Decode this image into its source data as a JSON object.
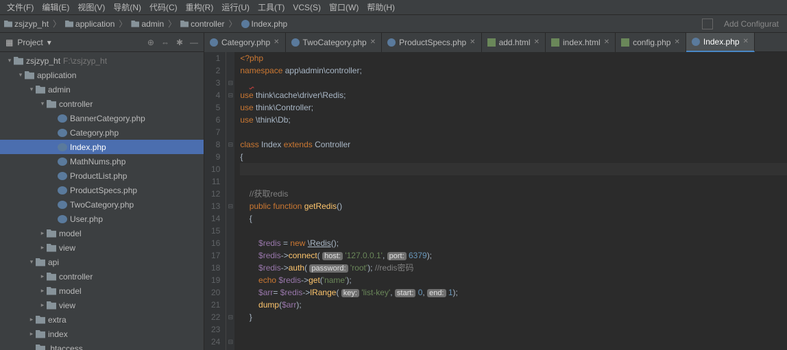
{
  "menus": [
    "文件(F)",
    "编辑(E)",
    "视图(V)",
    "导航(N)",
    "代码(C)",
    "重构(R)",
    "运行(U)",
    "工具(T)",
    "VCS(S)",
    "窗口(W)",
    "帮助(H)"
  ],
  "breadcrumb": {
    "items": [
      {
        "icon": "folder",
        "label": "zsjzyp_ht"
      },
      {
        "icon": "folder",
        "label": "application"
      },
      {
        "icon": "folder",
        "label": "admin"
      },
      {
        "icon": "folder",
        "label": "controller"
      },
      {
        "icon": "php",
        "label": "Index.php"
      }
    ],
    "add_config": "Add Configurat"
  },
  "project": {
    "title": "Project",
    "root": {
      "label": "zsjzyp_ht",
      "path": "F:\\zsjzyp_ht"
    },
    "nodes": [
      {
        "indent": 0,
        "arrow": "open",
        "icon": "folder",
        "label": "zsjzyp_ht",
        "path": "F:\\zsjzyp_ht"
      },
      {
        "indent": 1,
        "arrow": "open",
        "icon": "folder",
        "label": "application"
      },
      {
        "indent": 2,
        "arrow": "open",
        "icon": "folder",
        "label": "admin"
      },
      {
        "indent": 3,
        "arrow": "open",
        "icon": "folder",
        "label": "controller"
      },
      {
        "indent": 4,
        "arrow": "none",
        "icon": "php",
        "label": "BannerCategory.php"
      },
      {
        "indent": 4,
        "arrow": "none",
        "icon": "php",
        "label": "Category.php"
      },
      {
        "indent": 4,
        "arrow": "none",
        "icon": "php",
        "label": "Index.php",
        "selected": true
      },
      {
        "indent": 4,
        "arrow": "none",
        "icon": "php",
        "label": "MathNums.php"
      },
      {
        "indent": 4,
        "arrow": "none",
        "icon": "php",
        "label": "ProductList.php"
      },
      {
        "indent": 4,
        "arrow": "none",
        "icon": "php",
        "label": "ProductSpecs.php"
      },
      {
        "indent": 4,
        "arrow": "none",
        "icon": "php",
        "label": "TwoCategory.php"
      },
      {
        "indent": 4,
        "arrow": "none",
        "icon": "php",
        "label": "User.php"
      },
      {
        "indent": 3,
        "arrow": "closed",
        "icon": "folder",
        "label": "model"
      },
      {
        "indent": 3,
        "arrow": "closed",
        "icon": "folder",
        "label": "view"
      },
      {
        "indent": 2,
        "arrow": "open",
        "icon": "folder",
        "label": "api"
      },
      {
        "indent": 3,
        "arrow": "closed",
        "icon": "folder",
        "label": "controller"
      },
      {
        "indent": 3,
        "arrow": "closed",
        "icon": "folder",
        "label": "model"
      },
      {
        "indent": 3,
        "arrow": "closed",
        "icon": "folder",
        "label": "view"
      },
      {
        "indent": 2,
        "arrow": "closed",
        "icon": "folder",
        "label": "extra"
      },
      {
        "indent": 2,
        "arrow": "closed",
        "icon": "folder",
        "label": "index"
      },
      {
        "indent": 2,
        "arrow": "none",
        "icon": "file",
        "label": ".htaccess"
      }
    ]
  },
  "tabs": [
    {
      "icon": "php",
      "label": "Category.php"
    },
    {
      "icon": "php",
      "label": "TwoCategory.php"
    },
    {
      "icon": "php",
      "label": "ProductSpecs.php"
    },
    {
      "icon": "html",
      "label": "add.html"
    },
    {
      "icon": "html",
      "label": "index.html"
    },
    {
      "icon": "html",
      "label": "config.php"
    },
    {
      "icon": "php",
      "label": "Index.php",
      "active": true
    }
  ],
  "code": {
    "lines": [
      {
        "n": 1,
        "html": "<span class='k-tag'>&lt;?php</span>"
      },
      {
        "n": 2,
        "html": "<span class='k-kw'>namespace</span> app\\admin\\controller;"
      },
      {
        "n": 3,
        "html": "    <span class='k-err'>  </span>"
      },
      {
        "n": 4,
        "html": "<span class='k-kw'>use</span> think\\cache\\driver\\Redis;"
      },
      {
        "n": 5,
        "html": "<span class='k-kw'>use</span> think\\Controller;"
      },
      {
        "n": 6,
        "html": "<span class='k-kw'>use</span> \\think\\Db;"
      },
      {
        "n": 7,
        "html": ""
      },
      {
        "n": 8,
        "html": "<span class='k-kw'>class</span> <span class='k-class'>Index</span> <span class='k-kw'>extends</span> <span class='k-class'>Controller</span>"
      },
      {
        "n": 9,
        "html": "{"
      },
      {
        "n": 10,
        "html": "",
        "current": true
      },
      {
        "n": 11,
        "html": ""
      },
      {
        "n": 12,
        "html": "    <span class='k-cmt'>//获取redis</span>"
      },
      {
        "n": 13,
        "html": "    <span class='k-kw'>public</span> <span class='k-kw'>function</span> <span class='k-func'>getRedis</span>()"
      },
      {
        "n": 14,
        "html": "    {"
      },
      {
        "n": 15,
        "html": ""
      },
      {
        "n": 16,
        "html": "        <span class='k-var'>$redis</span> = <span class='k-kw'>new</span> <span class='k-new'>\\Redis</span>();"
      },
      {
        "n": 17,
        "html": "        <span class='k-var'>$redis</span>-&gt;<span class='k-func'>connect</span>( <span class='k-hint'>host:</span> <span class='k-str'>'127.0.0.1'</span>, <span class='k-hint'>port:</span> <span class='k-num'>6379</span>);"
      },
      {
        "n": 18,
        "html": "        <span class='k-var'>$redis</span>-&gt;<span class='k-func'>auth</span>( <span class='k-hint'>password:</span> <span class='k-str'>'root'</span>); <span class='k-cmt'>//redis密码</span>"
      },
      {
        "n": 19,
        "html": "        <span class='k-kw'>echo</span> <span class='k-var'>$redis</span>-&gt;<span class='k-func'>get</span>(<span class='k-str'>'name'</span>);"
      },
      {
        "n": 20,
        "html": "        <span class='k-var'>$arr</span>= <span class='k-var'>$redis</span>-&gt;<span class='k-func'>lRange</span>( <span class='k-hint'>key:</span> <span class='k-str'>'list-key'</span>, <span class='k-hint'>start:</span> <span class='k-num'>0</span>, <span class='k-hint'>end:</span> <span class='k-num'>1</span>);"
      },
      {
        "n": 21,
        "html": "        <span class='k-func'>dump</span>(<span class='k-var'>$arr</span>);"
      },
      {
        "n": 22,
        "html": "    }"
      },
      {
        "n": 23,
        "html": ""
      },
      {
        "n": 24,
        "html": ""
      }
    ],
    "folds": {
      "3": "⊟",
      "4": "⊟",
      "8": "⊟",
      "13": "⊟",
      "22": "⊟",
      "24": "⊟"
    }
  }
}
